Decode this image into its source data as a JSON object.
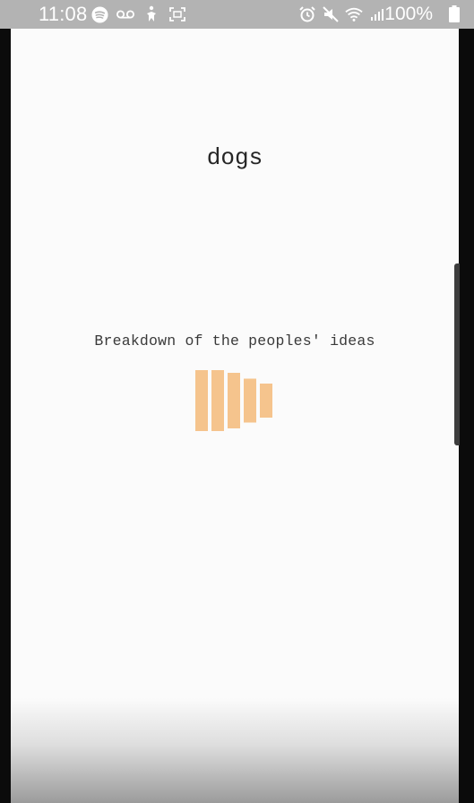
{
  "status_bar": {
    "time": "11:08",
    "battery_percent": "100%",
    "left_icons": [
      "spotify-icon",
      "voicemail-icon",
      "accessibility-icon",
      "screenshot-icon"
    ],
    "right_icons": [
      "alarm-icon",
      "mute-icon",
      "wifi-icon",
      "signal-icon",
      "battery-icon"
    ],
    "background_color": "#b3b3b3"
  },
  "app": {
    "title": "dogs",
    "breakdown_label": "Breakdown of the peoples' ideas",
    "background_color": "#fbfbfb"
  },
  "chart_data": {
    "type": "bar",
    "orientation": "vertical-centered",
    "bar_color": "#f5c48d",
    "values": [
      68,
      68,
      62,
      49,
      38
    ]
  }
}
